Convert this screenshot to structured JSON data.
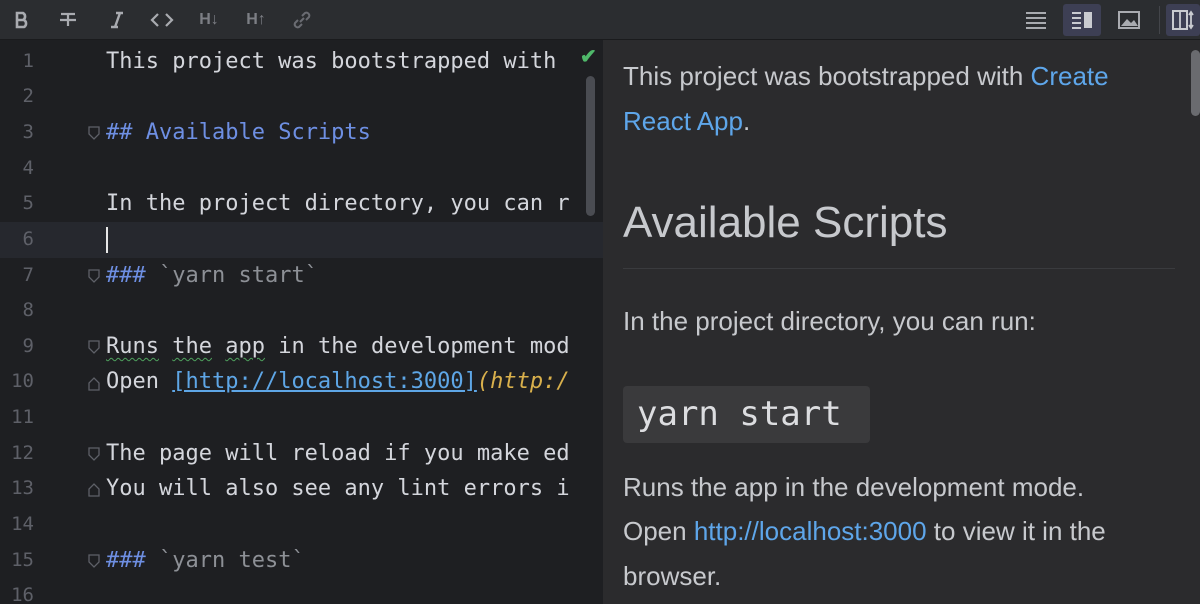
{
  "toolbar": {
    "buttons": [
      {
        "name": "bold-icon",
        "glyph": "B"
      },
      {
        "name": "strikethrough-icon",
        "glyph": "S"
      },
      {
        "name": "italic-icon",
        "glyph": "I"
      },
      {
        "name": "code-icon",
        "glyph": "<>"
      },
      {
        "name": "heading-decrease-icon",
        "glyph": "H↓"
      },
      {
        "name": "heading-increase-icon",
        "glyph": "H↑"
      },
      {
        "name": "link-icon",
        "glyph": "link"
      },
      {
        "name": "editor-only-icon",
        "glyph": "lines"
      },
      {
        "name": "editor-and-preview-icon",
        "glyph": "split"
      },
      {
        "name": "preview-only-icon",
        "glyph": "image"
      },
      {
        "name": "sync-scroll-icon",
        "glyph": "columns"
      }
    ]
  },
  "editor": {
    "line_numbers": [
      "1",
      "2",
      "3",
      "4",
      "5",
      "6",
      "7",
      "8",
      "9",
      "10",
      "11",
      "12",
      "13",
      "14",
      "15",
      "16"
    ],
    "current_line": 6,
    "lines": {
      "l1": "This project was bootstrapped with",
      "l3_mark": "##",
      "l3_text": "Available Scripts",
      "l5": "In the project directory, you can r",
      "l7_mark": "###",
      "l7_text": "`yarn start`",
      "l9_a": "Runs",
      "l9_b": "the",
      "l9_c": "app",
      "l9_d": "in the development mod",
      "l10_a": "Open",
      "l10_link": "[http://localhost:3000]",
      "l10_url": "(http:/",
      "l12": "The page will reload if you make ed",
      "l13": "You will also see any lint errors i",
      "l15_mark": "###",
      "l15_text": "`yarn test`"
    }
  },
  "preview": {
    "p1_a": "This project was bootstrapped with",
    "p1_link_a": "Create",
    "p1_link_b": "React App",
    "p1_end": ".",
    "h2": "Available Scripts",
    "p2": "In the project directory, you can run:",
    "h3_code": "yarn start",
    "p3_line1": "Runs the app in the development mode.",
    "p3_open": "Open",
    "p3_link": "http://localhost:3000",
    "p3_rest": "to view it in the",
    "p3_line3": "browser."
  },
  "colors": {
    "editor_bg": "#1e1f22",
    "preview_bg": "#2b2b2d",
    "heading_markup": "#6e8fe3",
    "link": "#5ea6ea",
    "url": "#d9b04c"
  }
}
